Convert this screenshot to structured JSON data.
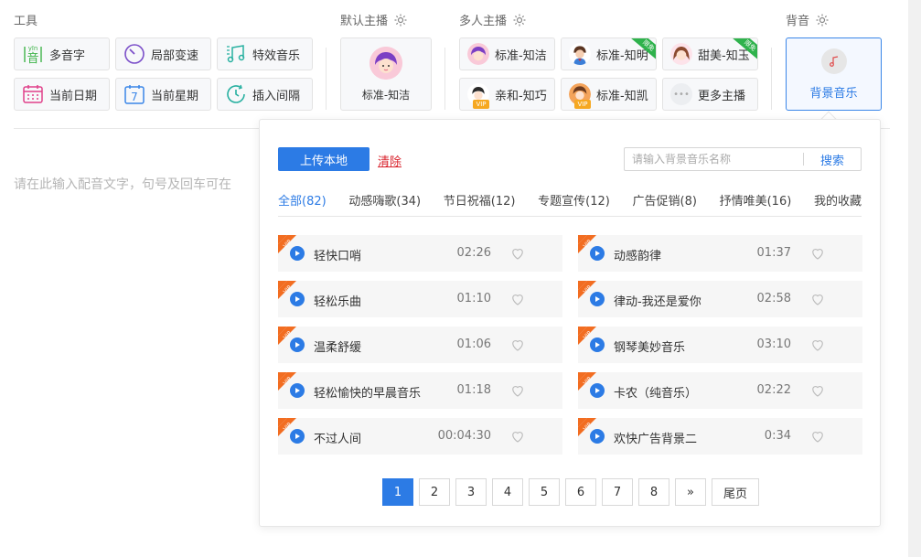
{
  "sections": {
    "tools_label": "工具",
    "default_anchor_label": "默认主播",
    "multi_anchor_label": "多人主播",
    "bgm_label": "背音"
  },
  "tools": [
    {
      "label": "多音字",
      "icon": "polyphone-icon"
    },
    {
      "label": "局部变速",
      "icon": "speed-dial-icon"
    },
    {
      "label": "特效音乐",
      "icon": "music-notes-icon"
    },
    {
      "label": "当前日期",
      "icon": "calendar-icon"
    },
    {
      "label": "当前星期",
      "icon": "calendar-week-icon"
    },
    {
      "label": "插入间隔",
      "icon": "clock-icon"
    }
  ],
  "tool_icon_text": {
    "polyphone": "音",
    "polyphone_pinyin": "yīn",
    "week_number": "7"
  },
  "default_anchor": {
    "name": "标准-知洁"
  },
  "multi_anchors": [
    {
      "name": "标准-知洁"
    },
    {
      "name": "标准-知明",
      "ribbon": "限免"
    },
    {
      "name": "甜美-知玉",
      "ribbon": "限免"
    },
    {
      "name": "亲和-知巧",
      "vip": "VIP"
    },
    {
      "name": "标准-知凯",
      "vip": "VIP"
    },
    {
      "name": "更多主播"
    }
  ],
  "bgm_button": {
    "label": "背景音乐"
  },
  "editor": {
    "placeholder": "请在此输入配音文字，句号及回车可在"
  },
  "popup": {
    "upload_label": "上传本地",
    "clear_label": "清除",
    "search_placeholder": "请输入背景音乐名称",
    "search_value": "",
    "search_button": "搜索",
    "vip_tag": "VIP",
    "tabs": [
      {
        "label": "全部(82)",
        "active": true
      },
      {
        "label": "动感嗨歌(34)"
      },
      {
        "label": "节日祝福(12)"
      },
      {
        "label": "专题宣传(12)"
      },
      {
        "label": "广告促销(8)"
      },
      {
        "label": "抒情唯美(16)"
      },
      {
        "label": "我的收藏"
      }
    ],
    "tracks": [
      {
        "name": "轻快口哨",
        "duration": "02:26"
      },
      {
        "name": "动感韵律",
        "duration": "01:37"
      },
      {
        "name": "轻松乐曲",
        "duration": "01:10"
      },
      {
        "name": "律动-我还是爱你",
        "duration": "02:58"
      },
      {
        "name": "温柔舒缓",
        "duration": "01:06"
      },
      {
        "name": "钢琴美妙音乐",
        "duration": "03:10"
      },
      {
        "name": "轻松愉快的早晨音乐",
        "duration": "01:18"
      },
      {
        "name": "卡农（纯音乐）",
        "duration": "02:22"
      },
      {
        "name": "不过人间",
        "duration": "00:04:30"
      },
      {
        "name": "欢快广告背景二",
        "duration": "0:34"
      }
    ],
    "pagination": {
      "pages": [
        "1",
        "2",
        "3",
        "4",
        "5",
        "6",
        "7",
        "8"
      ],
      "current": "1",
      "next_label": "»",
      "last_label": "尾页"
    }
  },
  "colors": {
    "accent": "#2c7be5",
    "vip": "#f26d21",
    "free_ribbon": "#2fb24c",
    "clear": "#d9232d"
  }
}
